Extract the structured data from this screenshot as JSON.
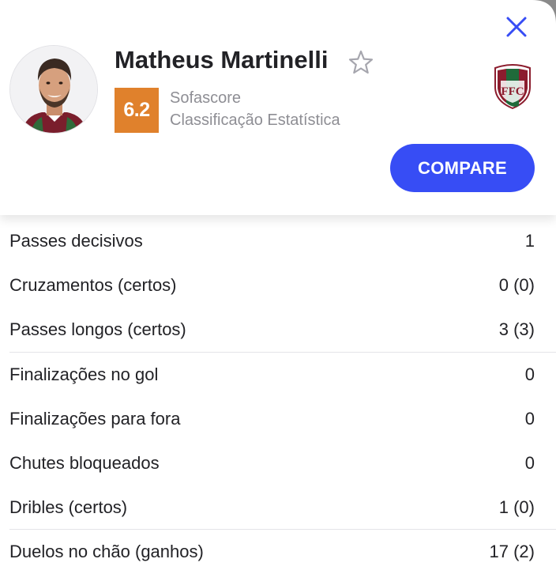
{
  "player": {
    "name": "Matheus Martinelli",
    "rating": "6.2",
    "rating_color": "#e0812c",
    "rating_source": "Sofascore",
    "rating_type": "Classificação Estatística",
    "team_crest": "fluminense-crest"
  },
  "header": {
    "close_icon": "close-icon",
    "favorite_icon": "star-outline-icon",
    "compare_label": "COMPARE",
    "accent_color": "#374df5"
  },
  "stats": [
    {
      "label": "Passes decisivos",
      "value": "1"
    },
    {
      "label": "Cruzamentos (certos)",
      "value": "0 (0)"
    },
    {
      "label": "Passes longos (certos)",
      "value": "3 (3)"
    },
    {
      "label": "Finalizações no gol",
      "value": "0"
    },
    {
      "label": "Finalizações para fora",
      "value": "0"
    },
    {
      "label": "Chutes bloqueados",
      "value": "0"
    },
    {
      "label": "Dribles (certos)",
      "value": "1 (0)"
    },
    {
      "label": "Duelos no chão (ganhos)",
      "value": "17 (2)"
    }
  ]
}
